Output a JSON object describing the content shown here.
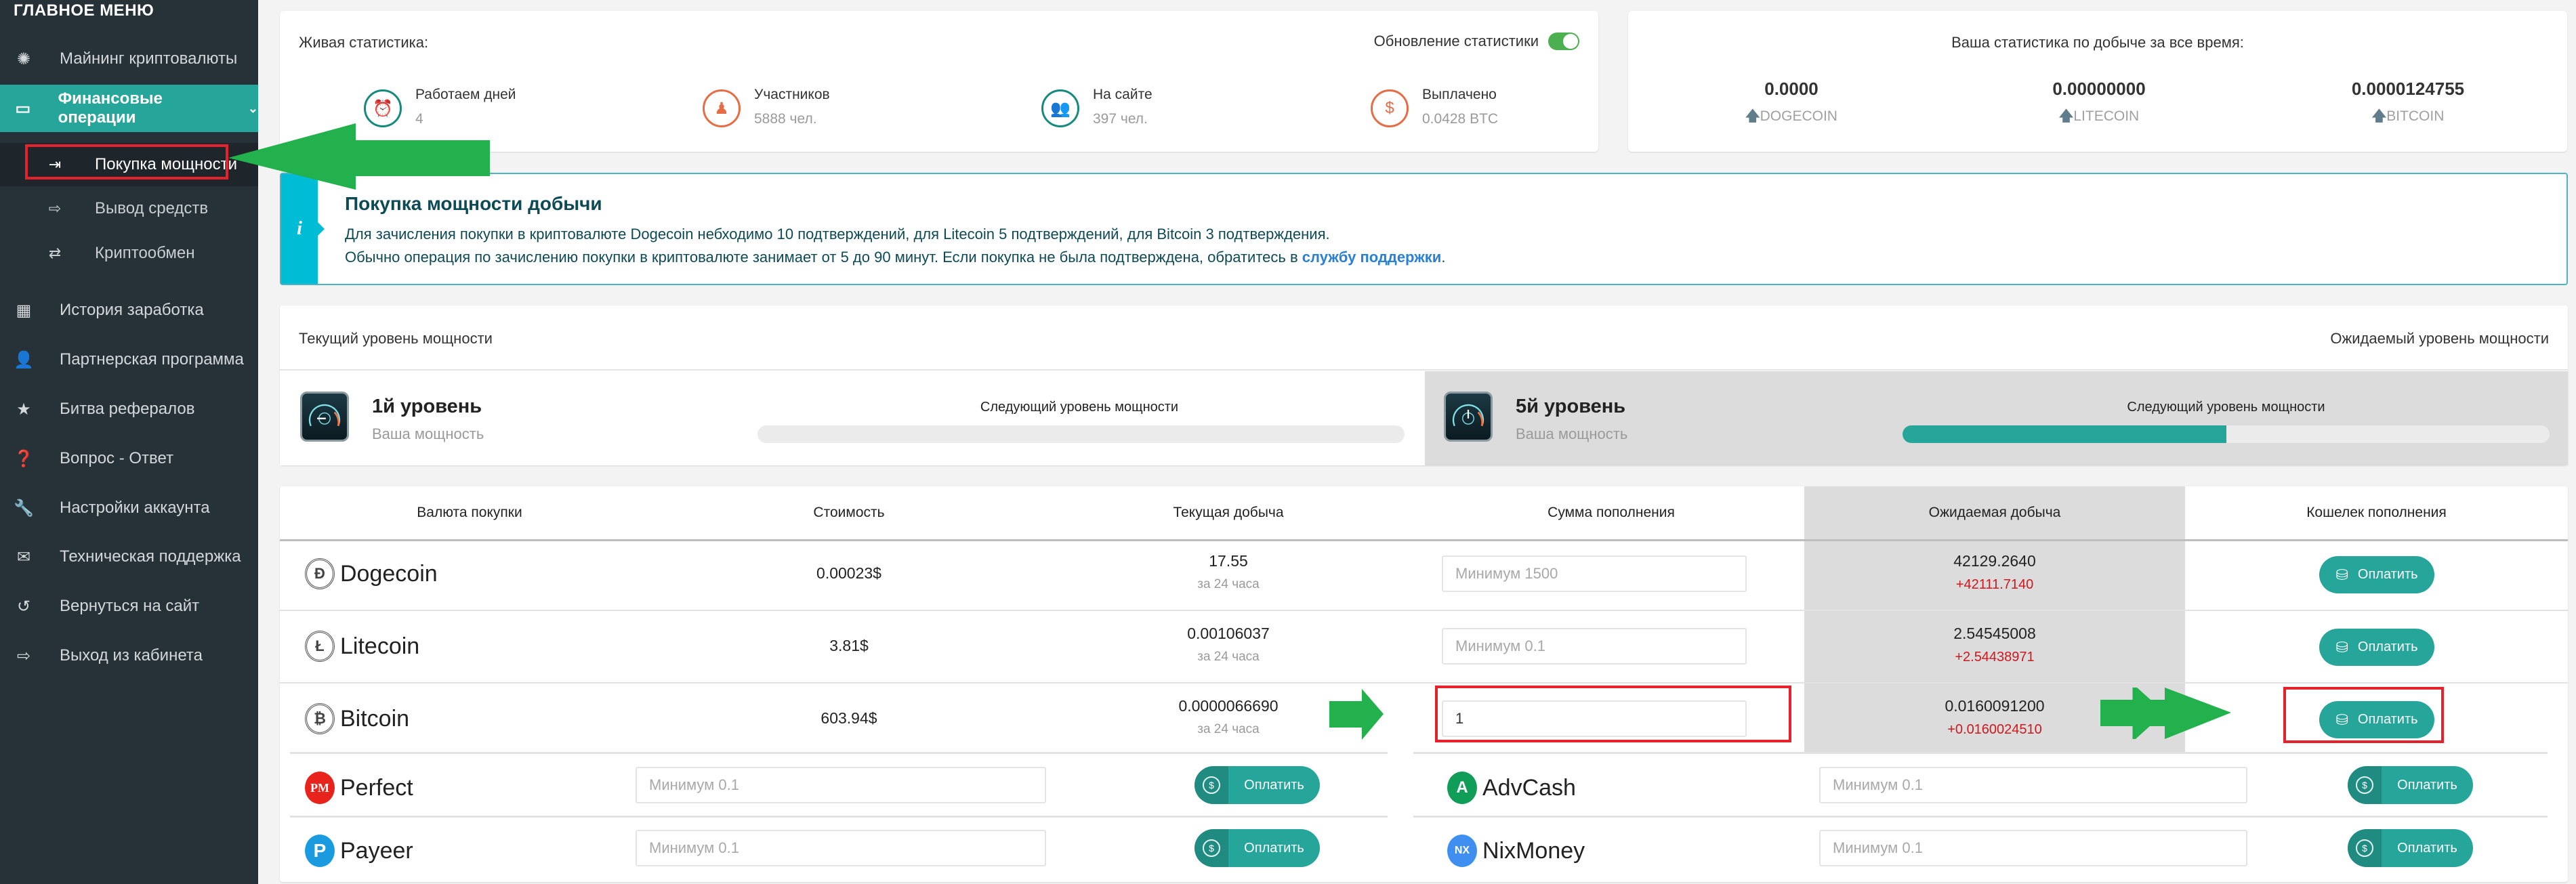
{
  "sidebar": {
    "title": "ГЛАВНОЕ МЕНЮ",
    "items": [
      {
        "label": "Майнинг криптовалюты",
        "icon": "aperture-icon"
      },
      {
        "label": "Финансовые операции",
        "icon": "wallet-icon",
        "active": true,
        "expanded": true
      },
      {
        "label": "История заработка",
        "icon": "calendar-icon"
      },
      {
        "label": "Партнерская программа",
        "icon": "user-icon"
      },
      {
        "label": "Битва рефералов",
        "icon": "medal-icon"
      },
      {
        "label": "Вопрос - Ответ",
        "icon": "question-icon"
      },
      {
        "label": "Настройки аккаунта",
        "icon": "wrench-icon"
      },
      {
        "label": "Техническая поддержка",
        "icon": "envelope-icon"
      },
      {
        "label": "Вернуться на сайт",
        "icon": "undo-icon"
      },
      {
        "label": "Выход из кабинета",
        "icon": "logout-icon"
      }
    ],
    "submenu": [
      {
        "label": "Покупка мощности",
        "icon": "database-in-icon",
        "active": true
      },
      {
        "label": "Вывод средств",
        "icon": "database-out-icon"
      },
      {
        "label": "Криптообмен",
        "icon": "database-sync-icon"
      }
    ]
  },
  "live_stats": {
    "title": "Живая статистика:",
    "toggle_label": "Обновление статистики",
    "toggle_on": true,
    "items": [
      {
        "label": "Работаем дней",
        "value": "4",
        "icon": "alarm-clock-icon"
      },
      {
        "label": "Участников",
        "value": "5888 чел.",
        "icon": "users-icon"
      },
      {
        "label": "На сайте",
        "value": "397 чел.",
        "icon": "people-icon"
      },
      {
        "label": "Выплачено",
        "value": "0.0428 BTC",
        "icon": "coins-icon"
      }
    ]
  },
  "mining_stats": {
    "title": "Ваша статистика по добыче за все время:",
    "items": [
      {
        "value": "0.0000",
        "label": "DOGECOIN"
      },
      {
        "value": "0.00000000",
        "label": "LITECOIN"
      },
      {
        "value": "0.0000124755",
        "label": "BITCOIN"
      }
    ]
  },
  "info": {
    "icon": "i",
    "title": "Покупка мощности добычи",
    "line1": "Для зачисления покупки в криптовалюте Dogecoin небходимо 10 подтверждений, для Litecoin 5 подтверждений, для Bitcoin 3 подтверждения.",
    "line2_prefix": "Обычно операция по зачислению покупки в криптовалюте занимает от 5 до 90 минут. Если покупка не была подтверждена, обратитесь в ",
    "line2_link": "службу поддержки",
    "line2_suffix": "."
  },
  "power": {
    "current_header": "Текущий уровень мощности",
    "expected_header": "Ожидаемый уровень мощности",
    "current": {
      "level": "1й уровень",
      "sub": "Ваша мощность",
      "next_label": "Следующий уровень мощности",
      "progress": 0
    },
    "expected": {
      "level": "5й уровень",
      "sub": "Ваша мощность",
      "next_label": "Следующий уровень мощности",
      "progress": 0.5
    }
  },
  "purchase_table": {
    "headers": [
      "Валюта покупки",
      "Стоимость",
      "Текущая добыча",
      "Сумма пополнения",
      "Ожидаемая добыча",
      "Кошелек пополнения"
    ],
    "rows": [
      {
        "coin": "Dogecoin",
        "icon": "Ð",
        "price": "0.00023$",
        "current": "17.55",
        "period": "за 24 часа",
        "placeholder": "Минимум 1500",
        "value": "",
        "expected": "42129.2640",
        "delta": "+42111.7140",
        "button": "Оплатить"
      },
      {
        "coin": "Litecoin",
        "icon": "Ł",
        "price": "3.81$",
        "current": "0.00106037",
        "period": "за 24 часа",
        "placeholder": "Минимум 0.1",
        "value": "",
        "expected": "2.54545008",
        "delta": "+2.54438971",
        "button": "Оплатить"
      },
      {
        "coin": "Bitcoin",
        "icon": "₿",
        "price": "603.94$",
        "current": "0.0000066690",
        "period": "за 24 часа",
        "placeholder": "",
        "value": "1",
        "expected": "0.0160091200",
        "delta": "+0.0160024510",
        "button": "Оплатить"
      }
    ],
    "payment_systems": [
      {
        "name": "Perfect",
        "logo": "PM",
        "color": "#e8231c",
        "placeholder": "Минимум 0.1",
        "button": "Оплатить"
      },
      {
        "name": "AdvCash",
        "logo": "A",
        "color": "#0f9d58",
        "placeholder": "Минимум 0.1",
        "button": "Оплатить"
      },
      {
        "name": "Payeer",
        "logo": "P",
        "color": "#1a9be0",
        "placeholder": "Минимум 0.1",
        "button": "Оплатить"
      },
      {
        "name": "NixMoney",
        "logo": "NX",
        "color": "#3f8ff0",
        "placeholder": "Минимум 0.1",
        "button": "Оплатить"
      }
    ]
  },
  "colors": {
    "accent": "#26a69a",
    "sidebar_bg": "#263238",
    "annotation_red": "#e3222b",
    "annotation_green": "#22b14c",
    "delta_red": "#d0171d"
  }
}
